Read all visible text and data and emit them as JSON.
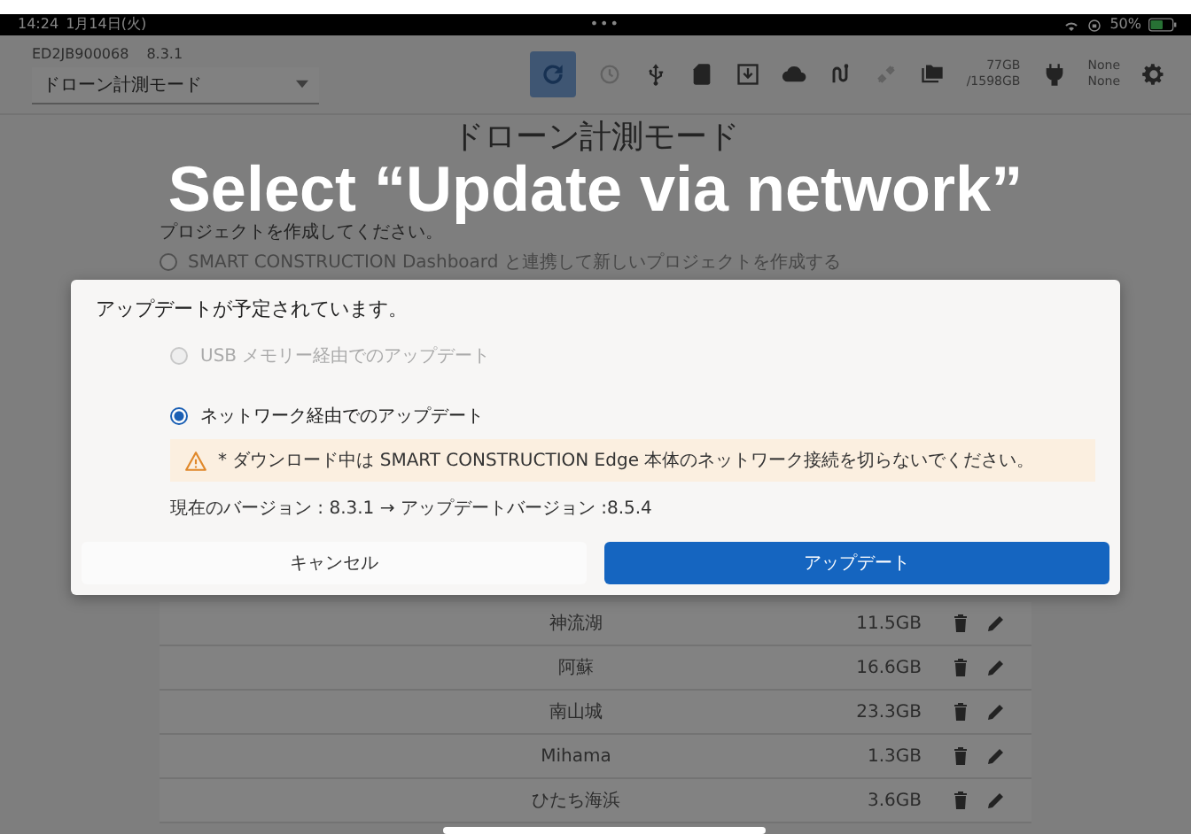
{
  "status_bar": {
    "time": "14:24",
    "date": "1月14日(火)",
    "dots": "•••",
    "battery": "50%"
  },
  "header": {
    "device_id": "ED2JB900068",
    "version": "8.3.1",
    "mode_select": {
      "value": "ドローン計測モード"
    },
    "toolbar": [
      {
        "kind": "icon",
        "selected": true,
        "disabled": false
      },
      {
        "kind": "icon",
        "selected": false,
        "disabled": true
      },
      {
        "kind": "icon",
        "selected": false,
        "disabled": false
      },
      {
        "kind": "icon",
        "selected": false,
        "disabled": false
      },
      {
        "kind": "icon",
        "selected": false,
        "disabled": false
      },
      {
        "kind": "icon",
        "selected": false,
        "disabled": false
      },
      {
        "kind": "icon",
        "selected": false,
        "disabled": false
      },
      {
        "kind": "icon",
        "selected": false,
        "disabled": true
      },
      {
        "kind": "icon",
        "selected": false,
        "disabled": false
      },
      {
        "kind": "text",
        "lines": [
          "77GB",
          "/1598GB"
        ]
      },
      {
        "kind": "icon",
        "selected": false,
        "disabled": false
      },
      {
        "kind": "text",
        "lines": [
          "None",
          "None"
        ]
      },
      {
        "kind": "icon",
        "selected": false,
        "disabled": false
      }
    ]
  },
  "page": {
    "title": "ドローン計測モード",
    "prompt": "プロジェクトを作成してください。",
    "option": {
      "label": "SMART CONSTRUCTION Dashboard と連携して新しいプロジェクトを作成する",
      "selected": false
    }
  },
  "projects": [
    {
      "name": "神流湖",
      "size": "11.5GB"
    },
    {
      "name": "阿蘇",
      "size": "16.6GB"
    },
    {
      "name": "南山城",
      "size": "23.3GB"
    },
    {
      "name": "Mihama",
      "size": "1.3GB"
    },
    {
      "name": "ひたち海浜",
      "size": "3.6GB"
    }
  ],
  "caption": "Select “Update via network”",
  "dialog": {
    "title": "アップデートが予定されています。",
    "options": [
      {
        "label": "USB メモリー経由でのアップデート",
        "selected": false,
        "disabled": true
      },
      {
        "label": "ネットワーク経由でのアップデート",
        "selected": true,
        "disabled": false
      }
    ],
    "warning": "* ダウンロード中は SMART CONSTRUCTION Edge 本体のネットワーク接続を切らないでください。",
    "version_info": "現在のバージョン : 8.3.1 → アップデートバージョン :8.5.4",
    "buttons": [
      {
        "label": "キャンセル",
        "kind": "secondary"
      },
      {
        "label": "アップデート",
        "kind": "primary"
      }
    ]
  }
}
